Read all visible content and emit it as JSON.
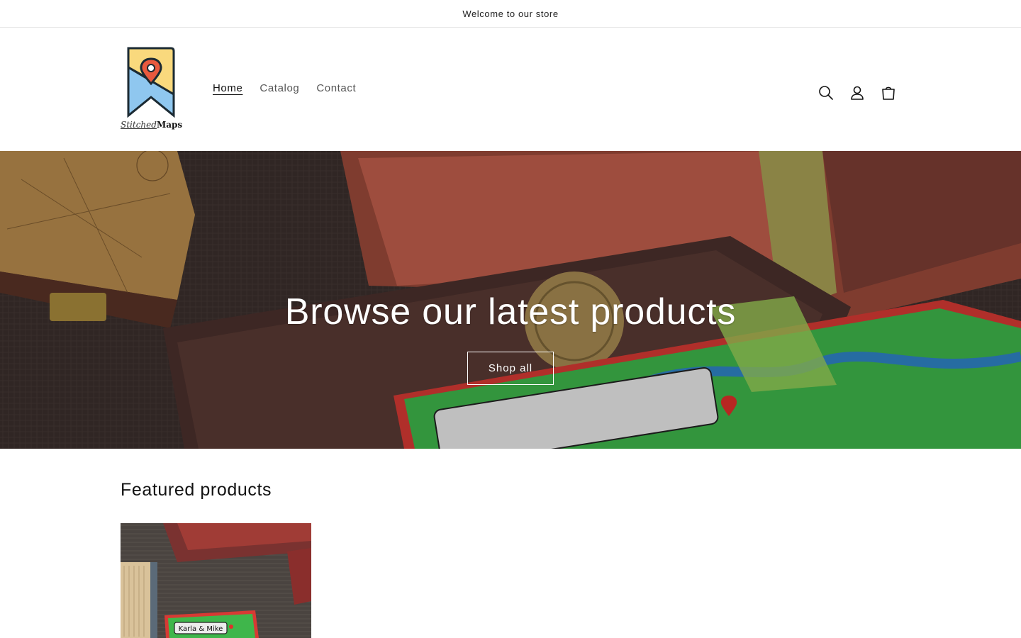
{
  "announcement": {
    "text": "Welcome to our store"
  },
  "logo": {
    "text_light": "Stitched",
    "text_bold": "Maps"
  },
  "nav": {
    "items": [
      {
        "label": "Home",
        "active": true
      },
      {
        "label": "Catalog",
        "active": false
      },
      {
        "label": "Contact",
        "active": false
      }
    ]
  },
  "header_icons": [
    "search-icon",
    "account-icon",
    "cart-icon"
  ],
  "hero": {
    "title": "Browse our latest products",
    "button_label": "Shop all",
    "patch_text": "Karla & Mike"
  },
  "featured": {
    "title": "Featured products",
    "products": [
      {
        "patch_text": "Karla & Mike"
      }
    ]
  },
  "colors": {
    "text": "#121212",
    "nav_inactive": "#555555",
    "logo_yellow": "#f9d97d",
    "logo_blue": "#8fc7ef",
    "logo_pin": "#e8593e"
  }
}
